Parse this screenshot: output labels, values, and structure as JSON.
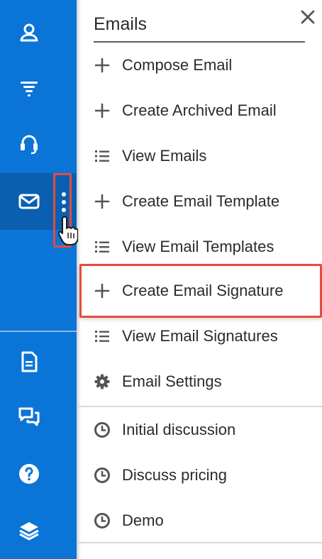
{
  "panel": {
    "title": "Emails",
    "close_label": "×"
  },
  "menu_items": [
    {
      "icon": "plus-icon",
      "label": "Compose Email"
    },
    {
      "icon": "plus-icon",
      "label": "Create Archived Email"
    },
    {
      "icon": "list-icon",
      "label": "View Emails"
    },
    {
      "icon": "plus-icon",
      "label": "Create Email Template"
    },
    {
      "icon": "list-icon",
      "label": "View Email Templates"
    },
    {
      "icon": "plus-icon",
      "label": "Create Email Signature"
    },
    {
      "icon": "list-icon",
      "label": "View Email Signatures"
    },
    {
      "icon": "gear-icon",
      "label": "Email Settings"
    }
  ],
  "recent_items": [
    {
      "icon": "clock-icon",
      "label": "Initial discussion"
    },
    {
      "icon": "clock-icon",
      "label": "Discuss pricing"
    },
    {
      "icon": "clock-icon",
      "label": "Demo"
    }
  ],
  "rail": {
    "items": [
      {
        "icon": "contacts-icon"
      },
      {
        "icon": "filter-icon"
      },
      {
        "icon": "headset-icon"
      },
      {
        "icon": "mail-icon",
        "active": true
      },
      {
        "icon": "document-icon"
      },
      {
        "icon": "chat-icon"
      },
      {
        "icon": "help-icon"
      },
      {
        "icon": "layers-icon"
      }
    ]
  },
  "colors": {
    "rail": "#0b74d7",
    "rail_active": "#0a5fb0",
    "highlight": "#e74b3c",
    "text": "#2b2b2b"
  }
}
